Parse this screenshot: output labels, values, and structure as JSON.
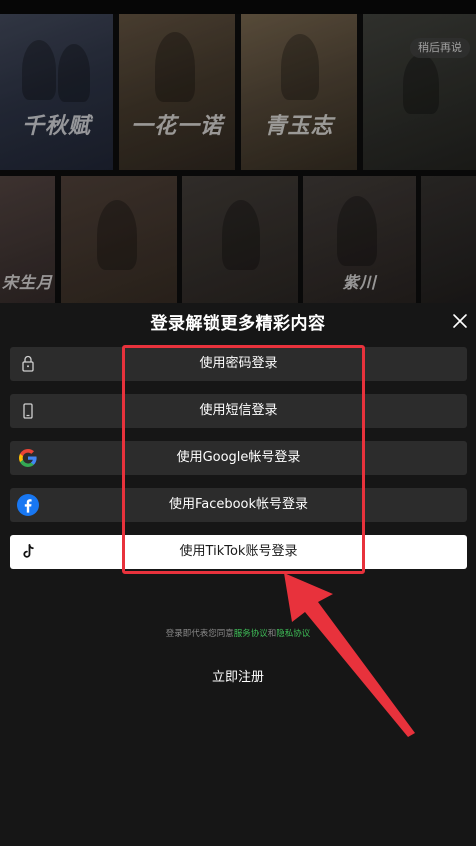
{
  "background": {
    "posters": [
      {
        "caption": "千秋赋"
      },
      {
        "caption": "一花一诺"
      },
      {
        "caption": "青玉志"
      },
      {
        "caption": ""
      },
      {
        "caption": "宋生月"
      },
      {
        "caption": ""
      },
      {
        "caption": ""
      },
      {
        "caption": "紫川"
      },
      {
        "caption": ""
      }
    ],
    "later_label": "稍后再说"
  },
  "sheet": {
    "title": "登录解锁更多精彩内容",
    "options": [
      {
        "label": "使用密码登录",
        "icon": "lock-icon"
      },
      {
        "label": "使用短信登录",
        "icon": "phone-icon"
      },
      {
        "label": "使用Google帐号登录",
        "icon": "google-icon"
      },
      {
        "label": "使用Facebook帐号登录",
        "icon": "facebook-icon"
      },
      {
        "label": "使用TikTok账号登录",
        "icon": "tiktok-icon"
      }
    ],
    "agreement": {
      "prefix": "登录即代表您同意",
      "terms": "服务协议",
      "and": "和",
      "privacy": "隐私协议"
    },
    "register_label": "立即注册"
  },
  "colors": {
    "background": "#161616",
    "option_bg": "#2c2c2c",
    "highlight": "#e8323c",
    "link": "#3fbf58",
    "google_blue": "#4285F4",
    "google_red": "#EA4335",
    "google_yellow": "#FBBC05",
    "google_green": "#34A853",
    "facebook_blue": "#1877F2"
  }
}
